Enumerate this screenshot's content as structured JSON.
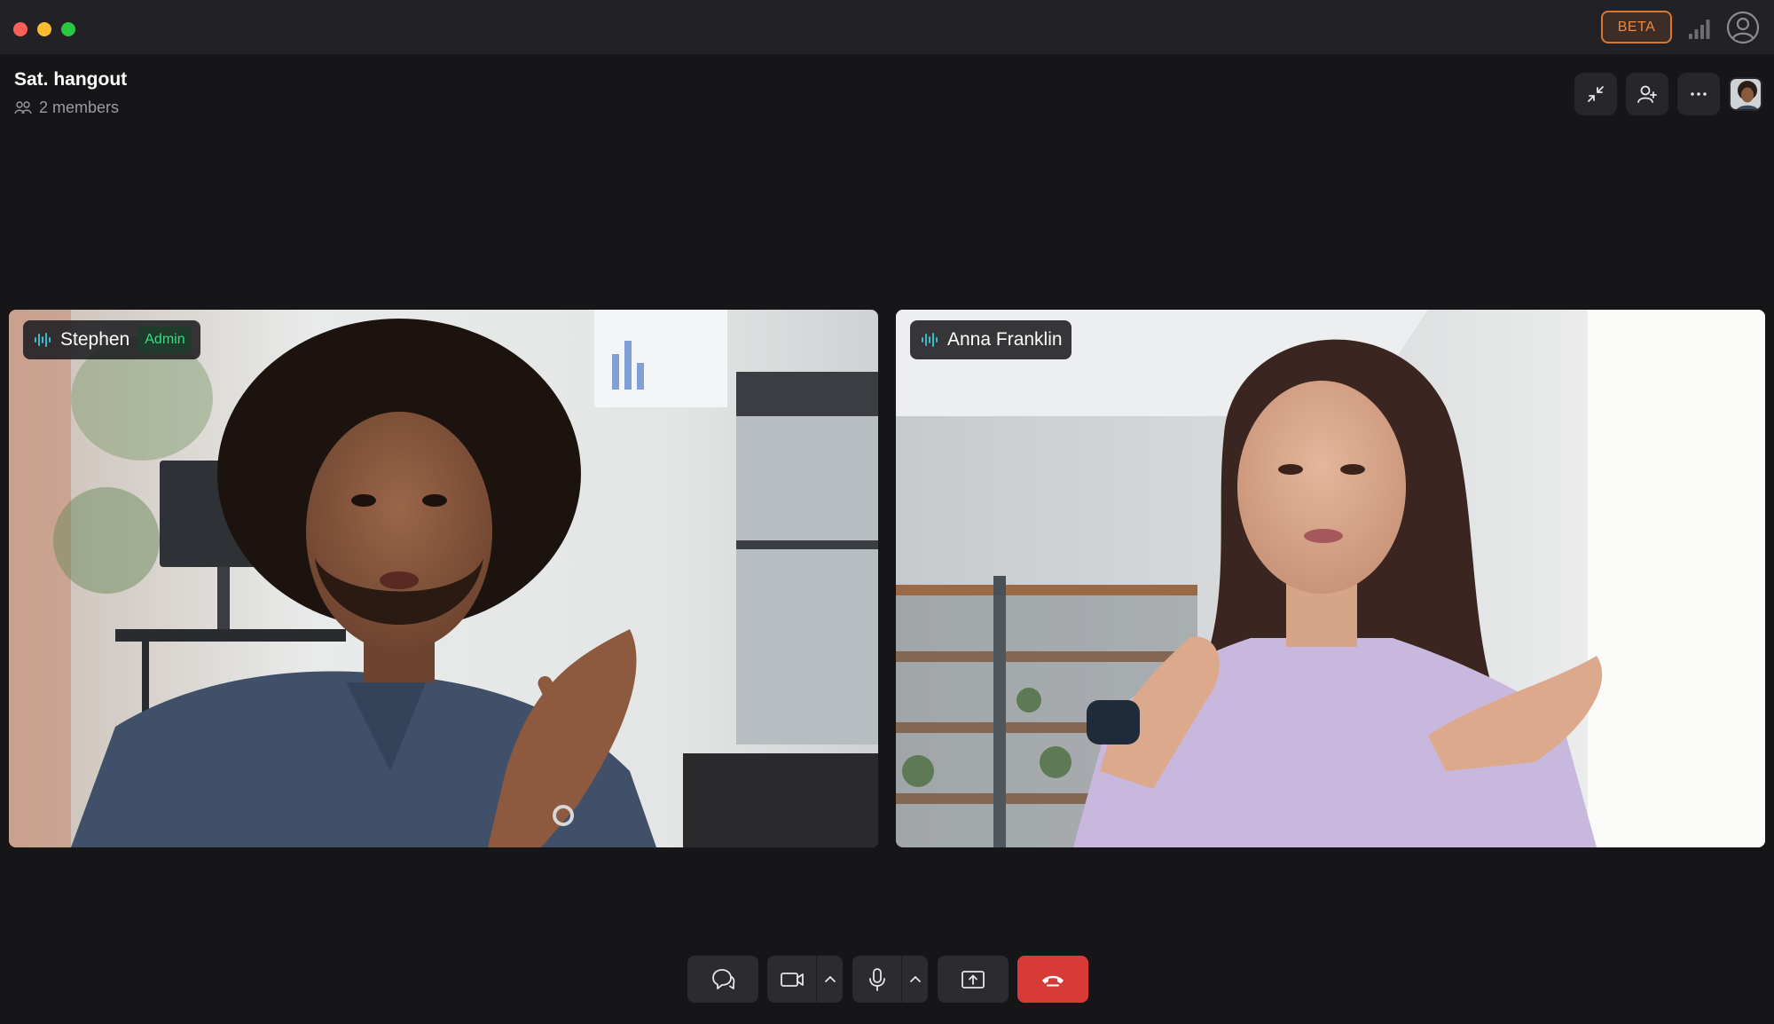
{
  "window": {
    "badge": "BETA",
    "icons": [
      "signal-bars-icon",
      "account-circle-icon"
    ]
  },
  "room": {
    "title": "Sat. hangout",
    "members_label": "2 members"
  },
  "header_actions": [
    "minimize-icon",
    "add-user-icon",
    "more-icon",
    "self-avatar"
  ],
  "participants": [
    {
      "name": "Stephen",
      "badge": "Admin",
      "speaking_icon": "audio-wave-icon"
    },
    {
      "name": "Anna Franklin",
      "speaking_icon": "audio-wave-icon"
    }
  ],
  "controls": [
    {
      "id": "chat",
      "icon": "chat-bubbles-icon"
    },
    {
      "id": "camera",
      "icon": "video-camera-icon"
    },
    {
      "id": "camera-options",
      "icon": "chevron-up-icon"
    },
    {
      "id": "mic",
      "icon": "microphone-icon"
    },
    {
      "id": "mic-options",
      "icon": "chevron-up-icon"
    },
    {
      "id": "share",
      "icon": "screen-share-icon"
    },
    {
      "id": "leave",
      "icon": "hang-up-icon"
    }
  ],
  "colors": {
    "accent_beta": "#f0883e",
    "admin_green": "#3ddc84",
    "hangup_red": "#d83a35",
    "wave_teal": "#3fb8c9"
  }
}
